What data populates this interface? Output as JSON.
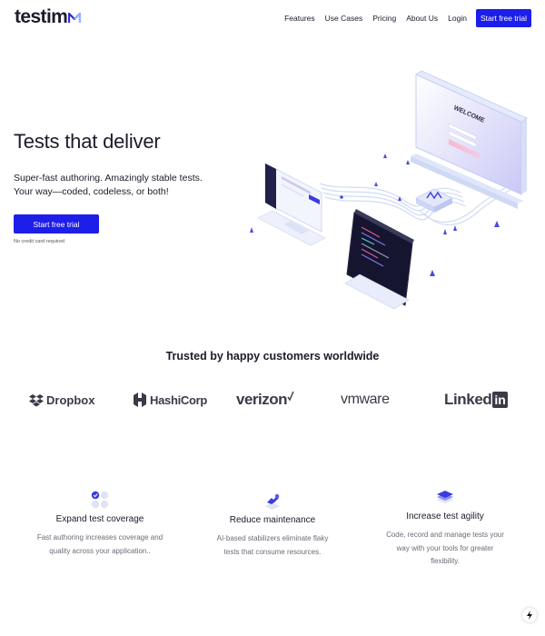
{
  "header": {
    "logo": "testim",
    "nav": [
      "Features",
      "Use Cases",
      "Pricing",
      "About Us",
      "Login"
    ],
    "cta": "Start free trial"
  },
  "hero": {
    "title": "Tests that deliver",
    "subtitle_line1": "Super-fast authoring. Amazingly stable tests.",
    "subtitle_line2": "Your way—coded, codeless, or both!",
    "cta": "Start free trial",
    "note": "No credit card required",
    "illustration_text": "WELCOME"
  },
  "trusted": {
    "title": "Trusted by happy customers worldwide",
    "customers": [
      "Dropbox",
      "HashiCorp",
      "verizon",
      "vmware",
      "Linked",
      "in"
    ]
  },
  "features": [
    {
      "title": "Expand test coverage",
      "desc_line1": "Fast authoring increases coverage and",
      "desc_line2": "quality across your application..",
      "icon": "coverage-icon"
    },
    {
      "title": "Reduce maintenance",
      "desc_line1": "AI-based stabilizers eliminate flaky",
      "desc_line2": "tests that consume resources.",
      "icon": "maintenance-icon"
    },
    {
      "title": "Increase test agility",
      "desc_line1": "Code, record and manage tests your",
      "desc_line2": "way with your tools for greater",
      "desc_line3": "flexibility.",
      "icon": "agility-icon"
    }
  ],
  "colors": {
    "brand": "#1e1eea",
    "text": "#1b1b2b",
    "muted": "#6b6b78"
  }
}
